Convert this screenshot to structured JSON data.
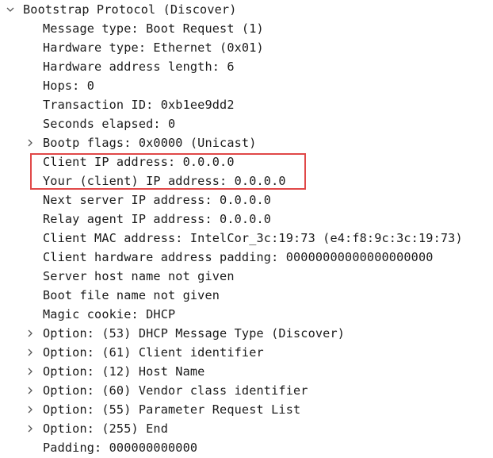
{
  "tree": {
    "root": {
      "label": "Bootstrap Protocol (Discover)",
      "expanded": true,
      "icon": "chevron-down-icon"
    },
    "fields": [
      {
        "label": "Message type: Boot Request (1)"
      },
      {
        "label": "Hardware type: Ethernet (0x01)"
      },
      {
        "label": "Hardware address length: 6"
      },
      {
        "label": "Hops: 0"
      },
      {
        "label": "Transaction ID: 0xb1ee9dd2"
      },
      {
        "label": "Seconds elapsed: 0"
      },
      {
        "label": "Bootp flags: 0x0000 (Unicast)",
        "expandable": true
      },
      {
        "label": "Client IP address: 0.0.0.0"
      },
      {
        "label": "Your (client) IP address: 0.0.0.0"
      },
      {
        "label": "Next server IP address: 0.0.0.0"
      },
      {
        "label": "Relay agent IP address: 0.0.0.0"
      },
      {
        "label": "Client MAC address: IntelCor_3c:19:73 (e4:f8:9c:3c:19:73)"
      },
      {
        "label": "Client hardware address padding: 00000000000000000000"
      },
      {
        "label": "Server host name not given"
      },
      {
        "label": "Boot file name not given"
      },
      {
        "label": "Magic cookie: DHCP"
      },
      {
        "label": "Option: (53) DHCP Message Type (Discover)",
        "expandable": true
      },
      {
        "label": "Option: (61) Client identifier",
        "expandable": true
      },
      {
        "label": "Option: (12) Host Name",
        "expandable": true
      },
      {
        "label": "Option: (60) Vendor class identifier",
        "expandable": true
      },
      {
        "label": "Option: (55) Parameter Request List",
        "expandable": true
      },
      {
        "label": "Option: (255) End",
        "expandable": true
      },
      {
        "label": "Padding: 000000000000"
      }
    ]
  },
  "colors": {
    "highlight_border": "#e04848",
    "text": "#1a1a1a",
    "arrow": "#555555"
  }
}
